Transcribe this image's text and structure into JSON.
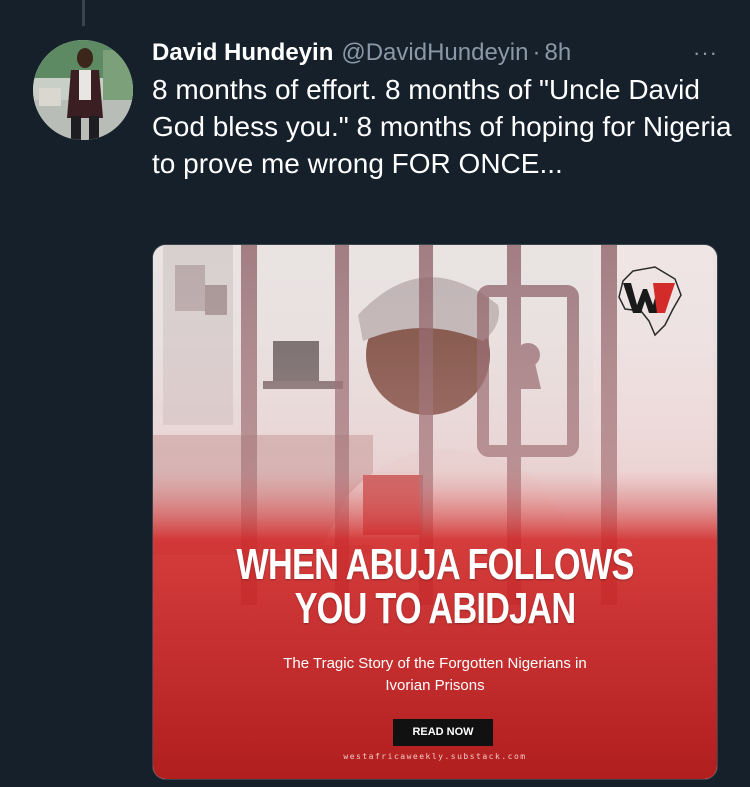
{
  "tweet": {
    "author_name": "David Hundeyin",
    "handle": "@DavidHundeyin",
    "separator": "·",
    "time": "8h",
    "more_label": "···",
    "text": "8 months of effort. 8 months of \"Uncle David God bless you.\" 8 months of hoping for Nigeria to prove me wrong FOR ONCE..."
  },
  "media": {
    "headline_line1": "WHEN ABUJA FOLLOWS",
    "headline_line2": "YOU TO ABIDJAN",
    "subtitle_line1": "The Tragic Story of the Forgotten Nigerians in",
    "subtitle_line2": "Ivorian Prisons",
    "cta_label": "READ NOW",
    "url": "westafricaweekly.substack.com",
    "logo_text": "WW",
    "colors": {
      "red": "#d32a2a",
      "dark_red": "#b01e1e",
      "bars": "#8a5c62"
    }
  },
  "colors": {
    "background": "#15202b",
    "secondary_text": "#8b98a5",
    "border": "#38444d"
  }
}
